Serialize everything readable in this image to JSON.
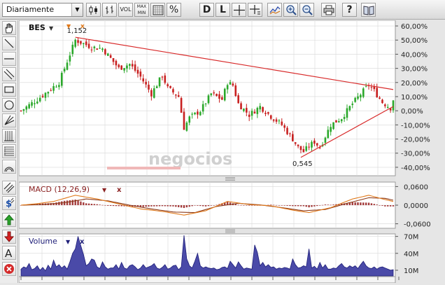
{
  "toolbar": {
    "period_value": "Diariamente",
    "buttons": [
      {
        "id": "candles",
        "icon": "candlestick-icon"
      },
      {
        "id": "ohlc",
        "icon": "ohlc-bars-icon"
      },
      {
        "id": "vol",
        "label": "VOL"
      },
      {
        "id": "maxmin",
        "label_top": "MAX",
        "label_bottom": "MIN"
      },
      {
        "id": "grid",
        "icon": "grid-icon"
      },
      {
        "id": "percent",
        "label": "%"
      },
      {
        "id": "daily",
        "label": "D"
      },
      {
        "id": "log",
        "label": "L"
      },
      {
        "id": "crosshair",
        "icon": "crosshair-icon"
      },
      {
        "id": "crosshair-label",
        "icon": "crosshair-label-icon"
      },
      {
        "id": "indicators",
        "icon": "indicators-icon"
      },
      {
        "id": "zoom-in",
        "icon": "zoom-in-icon"
      },
      {
        "id": "zoom-out",
        "icon": "zoom-out-icon"
      },
      {
        "id": "print",
        "icon": "print-icon"
      },
      {
        "id": "help",
        "label": "?"
      },
      {
        "id": "book",
        "icon": "book-icon"
      }
    ]
  },
  "tools": [
    "hand-icon",
    "trend-line-icon",
    "horizontal-line-icon",
    "parallel-lines-icon",
    "rectangle-icon",
    "circle-icon",
    "pitchfork-icon",
    "gann-lines-icon",
    "fibonacci-icon",
    "fibonacci-arcs-icon",
    "channel-icon",
    "dollar-icon",
    "buy-arrow-icon",
    "sell-arrow-icon",
    "text-icon",
    "delete-icon"
  ],
  "colors": {
    "up_candle": "#2aa82a",
    "down_candle": "#c82020",
    "trend_line": "#d82a2a",
    "macd_line": "#e07818",
    "signal_line": "#8b3a1a",
    "histogram": "#a33a3a",
    "volume_fill": "#4a4aa8",
    "volume_stroke": "#1e1e78",
    "panel_bg": "#ffffff",
    "grid": "#d7d7d7"
  },
  "watermark": "negocios",
  "chart_data": [
    {
      "type": "candlestick",
      "title": "BES",
      "yunit": "%",
      "ylim": [
        -45,
        63
      ],
      "yticks": [
        "60,00%",
        "50,00%",
        "40,00%",
        "30,00%",
        "20,00%",
        "10,00%",
        "0,00%",
        "-10,00%",
        "-20,00%",
        "-30,00%",
        "-40,00%"
      ],
      "ytick_values": [
        60,
        50,
        40,
        30,
        20,
        10,
        0,
        -10,
        -20,
        -30,
        -40
      ],
      "annotations": [
        {
          "text": "1,152",
          "index": 20,
          "value": 52
        },
        {
          "text": "0,545",
          "index": 103,
          "value": -33
        }
      ],
      "trend_lines": [
        {
          "from": [
            20,
            52
          ],
          "to": [
            137,
            15
          ]
        },
        {
          "from": [
            103,
            -33
          ],
          "to": [
            137,
            3
          ]
        }
      ],
      "close_path": [
        [
          0,
          0
        ],
        [
          6,
          8
        ],
        [
          14,
          20
        ],
        [
          20,
          50
        ],
        [
          26,
          45
        ],
        [
          30,
          44
        ],
        [
          36,
          30
        ],
        [
          40,
          33
        ],
        [
          44,
          24
        ],
        [
          48,
          12
        ],
        [
          52,
          25
        ],
        [
          54,
          16
        ],
        [
          58,
          10
        ],
        [
          60,
          -12
        ],
        [
          62,
          -5
        ],
        [
          66,
          0
        ],
        [
          70,
          12
        ],
        [
          74,
          8
        ],
        [
          76,
          20
        ],
        [
          78,
          18
        ],
        [
          80,
          5
        ],
        [
          84,
          -3
        ],
        [
          88,
          3
        ],
        [
          92,
          -4
        ],
        [
          96,
          -10
        ],
        [
          100,
          -20
        ],
        [
          102,
          -26
        ],
        [
          104,
          -29
        ],
        [
          106,
          -25
        ],
        [
          108,
          -22
        ],
        [
          110,
          -26
        ],
        [
          114,
          -10
        ],
        [
          118,
          -5
        ],
        [
          122,
          5
        ],
        [
          126,
          14
        ],
        [
          128,
          18
        ],
        [
          130,
          14
        ],
        [
          133,
          6
        ],
        [
          136,
          2
        ],
        [
          137,
          8
        ]
      ]
    },
    {
      "type": "line",
      "title": "MACD (12,26,9)",
      "ylim": [
        -0.07,
        0.07
      ],
      "yticks": [
        "0,0600",
        "0,0000",
        "-0,0600"
      ],
      "ytick_values": [
        0.06,
        0,
        -0.06
      ],
      "macd_path": [
        [
          0,
          0
        ],
        [
          6,
          0.005
        ],
        [
          12,
          0.012
        ],
        [
          20,
          0.032
        ],
        [
          28,
          0.02
        ],
        [
          36,
          0.004
        ],
        [
          44,
          -0.012
        ],
        [
          52,
          -0.02
        ],
        [
          60,
          -0.032
        ],
        [
          68,
          -0.018
        ],
        [
          76,
          0.012
        ],
        [
          84,
          0.002
        ],
        [
          92,
          -0.002
        ],
        [
          100,
          -0.016
        ],
        [
          106,
          -0.024
        ],
        [
          114,
          -0.008
        ],
        [
          122,
          0.02
        ],
        [
          128,
          0.032
        ],
        [
          134,
          0.018
        ],
        [
          137,
          0.012
        ]
      ],
      "signal_path": [
        [
          0,
          0
        ],
        [
          8,
          0.002
        ],
        [
          16,
          0.008
        ],
        [
          24,
          0.02
        ],
        [
          32,
          0.014
        ],
        [
          40,
          0
        ],
        [
          48,
          -0.012
        ],
        [
          56,
          -0.022
        ],
        [
          64,
          -0.024
        ],
        [
          72,
          -0.004
        ],
        [
          80,
          0.006
        ],
        [
          88,
          0.001
        ],
        [
          96,
          -0.008
        ],
        [
          104,
          -0.018
        ],
        [
          112,
          -0.014
        ],
        [
          120,
          0.006
        ],
        [
          128,
          0.024
        ],
        [
          134,
          0.022
        ],
        [
          137,
          0.016
        ]
      ]
    },
    {
      "type": "area",
      "title": "Volume",
      "ylim": [
        0,
        72
      ],
      "yunit": "M",
      "yticks": [
        "70M",
        "40M",
        "10M"
      ],
      "ytick_values": [
        70,
        40,
        10
      ],
      "values": [
        12,
        16,
        14,
        22,
        11,
        13,
        18,
        10,
        15,
        9,
        19,
        12,
        28,
        16,
        20,
        14,
        18,
        12,
        25,
        40,
        48,
        70,
        54,
        38,
        18,
        22,
        30,
        28,
        16,
        13,
        25,
        16,
        12,
        14,
        14,
        20,
        12,
        24,
        14,
        12,
        18,
        20,
        16,
        11,
        14,
        20,
        14,
        16,
        18,
        22,
        14,
        12,
        15,
        20,
        12,
        14,
        18,
        19,
        11,
        16,
        72,
        30,
        18,
        14,
        26,
        40,
        18,
        14,
        16,
        14,
        13,
        14,
        11,
        12,
        15,
        16,
        13,
        26,
        20,
        14,
        25,
        18,
        12,
        14,
        13,
        12,
        55,
        42,
        18,
        24,
        16,
        20,
        15,
        16,
        12,
        14,
        13,
        15,
        14,
        12,
        30,
        20,
        14,
        15,
        18,
        16,
        48,
        14,
        17,
        12,
        24,
        14,
        20,
        12,
        12,
        14,
        13,
        18,
        22,
        16,
        14,
        18,
        15,
        18,
        13,
        20,
        26,
        18,
        14,
        13,
        16,
        12,
        15,
        16,
        14,
        12,
        10,
        11
      ]
    }
  ],
  "panels": {
    "price": {
      "name": "BES",
      "dropdown": "▼"
    },
    "macd": {
      "name": "MACD (12,26,9)",
      "dropdown": "▼",
      "remove": "x"
    },
    "volume": {
      "name": "Volume",
      "dropdown": "▼",
      "remove": "x"
    }
  },
  "price_markers": {
    "triangle": "▼",
    "remove": "x"
  }
}
